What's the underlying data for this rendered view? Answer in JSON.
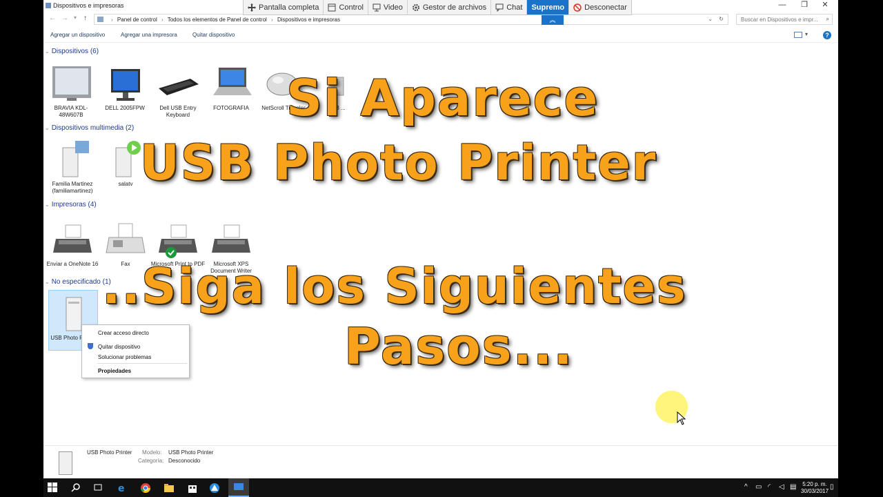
{
  "window": {
    "title": "Dispositivos e impresoras",
    "minimize_glyph": "—",
    "restore_glyph": "❐",
    "close_glyph": "✕"
  },
  "supremo_toolbar": {
    "items": [
      {
        "label": "Pantalla completa",
        "icon": "move-icon"
      },
      {
        "label": "Control",
        "icon": "window-icon"
      },
      {
        "label": "Video",
        "icon": "monitor-icon"
      },
      {
        "label": "Gestor de archivos",
        "icon": "folder-icon"
      },
      {
        "label": "Chat",
        "icon": "chat-icon"
      }
    ],
    "brand": "Supremo",
    "disconnect": "Desconectar",
    "accent": "#1a73c8"
  },
  "address": {
    "breadcrumbs": [
      "Panel de control",
      "Todos los elementos de Panel de control",
      "Dispositivos e impresoras"
    ],
    "separator": "›",
    "search_placeholder": "Buscar en Dispositivos e impr..."
  },
  "commands": {
    "add_device": "Agregar un dispositivo",
    "add_printer": "Agregar una impresora",
    "remove_device": "Quitar dispositivo",
    "help": "?"
  },
  "groups": {
    "devices": {
      "header": "Dispositivos (6)",
      "items": [
        {
          "label": "BRAVIA KDL-48W607B",
          "icon": "tv-icon"
        },
        {
          "label": "DELL 2005FPW",
          "icon": "monitor-icon"
        },
        {
          "label": "Dell USB Entry Keyboard",
          "icon": "keyboard-icon"
        },
        {
          "label": "FOTOGRAFIA",
          "icon": "laptop-icon"
        },
        {
          "label": "NetScroll Traveler",
          "icon": "mouse-icon"
        },
        {
          "label": "USB ...",
          "icon": "usb-device-icon"
        }
      ]
    },
    "multimedia": {
      "header": "Dispositivos multimedia (2)",
      "items": [
        {
          "label": "Familia Martinez (familiamartinez)",
          "icon": "media-server-icon"
        },
        {
          "label": "salatv",
          "icon": "media-player-icon"
        }
      ]
    },
    "printers": {
      "header": "Impresoras (4)",
      "items": [
        {
          "label": "Enviar a OneNote 16",
          "icon": "printer-icon"
        },
        {
          "label": "Fax",
          "icon": "fax-icon"
        },
        {
          "label": "Microsoft Print to PDF",
          "icon": "printer-icon"
        },
        {
          "label": "Microsoft XPS Document Writer",
          "icon": "printer-icon"
        }
      ]
    },
    "unspecified": {
      "header": "No especificado (1)",
      "items": [
        {
          "label": "USB Photo Printer",
          "icon": "generic-device-icon"
        }
      ]
    }
  },
  "context_menu": {
    "items": [
      "Crear acceso directo",
      "Quitar dispositivo",
      "Solucionar problemas",
      "Propiedades"
    ]
  },
  "details": {
    "name": "USB Photo Printer",
    "model_label": "Modelo:",
    "model_value": "USB Photo Printer",
    "category_label": "Categoría:",
    "category_value": "Desconocido"
  },
  "taskbar": {
    "time": "5:20 p. m.",
    "date": "30/03/2017"
  },
  "overlay_text": {
    "line1": "Si Aparece",
    "line2": "USB Photo Printer",
    "line3": "..Siga los Siguientes",
    "line4": "Pasos...",
    "color": "#f7a21a"
  }
}
